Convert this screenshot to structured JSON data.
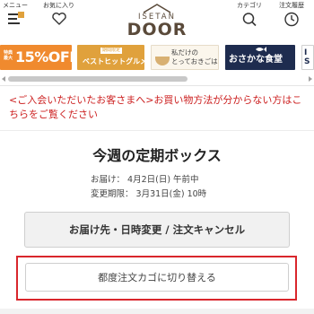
{
  "header": {
    "menu_label": "メニュー",
    "favorites_label": "お気に入り",
    "category_label": "カテゴリ",
    "history_label": "注文履歴",
    "logo_line1": "ISETAN",
    "logo_line2": "DOOR",
    "icons": {
      "menu": "menu-icon",
      "favorites": "heart-icon",
      "category": "search-icon",
      "history": "clock-icon"
    }
  },
  "banners": [
    {
      "small": "特典最大",
      "text": "15%OFF",
      "color": "#f08a2e"
    },
    {
      "tag": "期間限定",
      "text": "ベストヒットグルメ",
      "color": "#e0a13c"
    },
    {
      "line1": "私だけの",
      "line2": "とっておきごはん"
    },
    {
      "text": "おさかな食堂",
      "color": "#1e2c4f"
    },
    {
      "text": "I S"
    }
  ],
  "notice": "<ご入会いただいたお客さまへ>お買い物方法が分からない方はこちらをご覧ください",
  "main": {
    "title": "今週の定期ボックス",
    "delivery": "お届け： 4月2日(日) 午前中",
    "deadline": "変更期限： 3月31日(金) 10時",
    "change_button": "お届け先・日時変更 / 注文キャンセル",
    "switch_button": "都度注文カゴに切り替える"
  },
  "colors": {
    "accent_red": "#cc1f1f",
    "highlight_border": "#d9262c",
    "logo_brown": "#5a4a3a"
  }
}
